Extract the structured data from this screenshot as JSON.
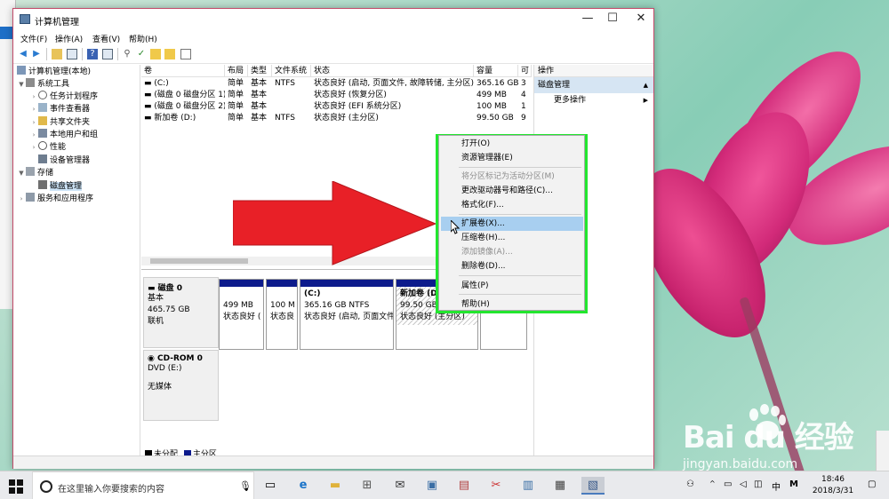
{
  "window": {
    "title": "计算机管理",
    "controls": {
      "minimize": "—",
      "maximize": "☐",
      "close": "✕"
    }
  },
  "menubar": [
    "文件(F)",
    "操作(A)",
    "查看(V)",
    "帮助(H)"
  ],
  "toolbar": [
    "back-arrow-icon",
    "forward-arrow-icon",
    "folder-up-icon",
    "show-hide-tree-icon",
    "help-icon",
    "properties-icon",
    "connect-icon",
    "check-icon",
    "folder-open-icon",
    "folder-search-icon",
    "panel-icon"
  ],
  "tree": {
    "root": "计算机管理(本地)",
    "system_tools": "系统工具",
    "task_scheduler": "任务计划程序",
    "event_viewer": "事件查看器",
    "shared_folders": "共享文件夹",
    "local_users": "本地用户和组",
    "performance": "性能",
    "device_manager": "设备管理器",
    "storage": "存储",
    "disk_management": "磁盘管理",
    "services_apps": "服务和应用程序"
  },
  "volume_table": {
    "headers": [
      "卷",
      "布局",
      "类型",
      "文件系统",
      "状态",
      "容量",
      "可"
    ],
    "rows": [
      [
        "(C:)",
        "简单",
        "基本",
        "NTFS",
        "状态良好 (启动, 页面文件, 故障转储, 主分区)",
        "365.16 GB",
        "3"
      ],
      [
        "(磁盘 0 磁盘分区 1)",
        "简单",
        "基本",
        "",
        "状态良好 (恢复分区)",
        "499 MB",
        "4"
      ],
      [
        "(磁盘 0 磁盘分区 2)",
        "简单",
        "基本",
        "",
        "状态良好 (EFI 系统分区)",
        "100 MB",
        "1"
      ],
      [
        "新加卷 (D:)",
        "简单",
        "基本",
        "NTFS",
        "状态良好 (主分区)",
        "99.50 GB",
        "9"
      ]
    ]
  },
  "disks": {
    "disk0": {
      "name": "磁盘 0",
      "type": "基本",
      "size": "465.75 GB",
      "status": "联机"
    },
    "cdrom": {
      "name": "CD-ROM 0",
      "type": "DVD (E:)",
      "status": "无媒体"
    },
    "partitions": [
      {
        "title": "",
        "size": "499 MB",
        "status": "状态良好 ("
      },
      {
        "title": "",
        "size": "100 M",
        "status": "状态良"
      },
      {
        "title": "(C:)",
        "size": "365.16 GB NTFS",
        "status": "状态良好 (启动, 页面文件"
      },
      {
        "title": "新加卷 (D:)",
        "size": "99.50 GB NTFS",
        "status": "状态良好 (主分区)"
      }
    ],
    "legend": {
      "unallocated": "未分配",
      "primary": "主分区"
    }
  },
  "actions": {
    "header": "操作",
    "section": "磁盘管理",
    "more": "更多操作"
  },
  "context_menu": {
    "items": [
      {
        "label": "打开(O)",
        "enabled": true
      },
      {
        "label": "资源管理器(E)",
        "enabled": true
      },
      {
        "label": "将分区标记为活动分区(M)",
        "enabled": false
      },
      {
        "label": "更改驱动器号和路径(C)...",
        "enabled": true
      },
      {
        "label": "格式化(F)...",
        "enabled": true
      },
      {
        "label": "扩展卷(X)...",
        "enabled": true,
        "highlighted": true
      },
      {
        "label": "压缩卷(H)...",
        "enabled": true
      },
      {
        "label": "添加镜像(A)...",
        "enabled": false
      },
      {
        "label": "删除卷(D)...",
        "enabled": true
      },
      {
        "label": "属性(P)",
        "enabled": true
      },
      {
        "label": "帮助(H)",
        "enabled": true
      }
    ],
    "frame_color": "#22e62f"
  },
  "annotation": {
    "arrow_color": "#e82027"
  },
  "watermark": {
    "logo": "Bai  du 经验",
    "url": "jingyan.baidu.com"
  },
  "taskbar": {
    "search_placeholder": "在这里输入你要搜索的内容",
    "apps": [
      "task-view-icon",
      "edge-icon",
      "file-explorer-icon",
      "store-icon",
      "mail-icon",
      "remote-desktop-icon",
      "paint-icon",
      "snipping-icon",
      "notepad-icon",
      "calculator-icon",
      "computer-management-icon"
    ],
    "ime": "中",
    "ime_mode": "M",
    "time": "18:46",
    "date": "2018/3/31"
  }
}
